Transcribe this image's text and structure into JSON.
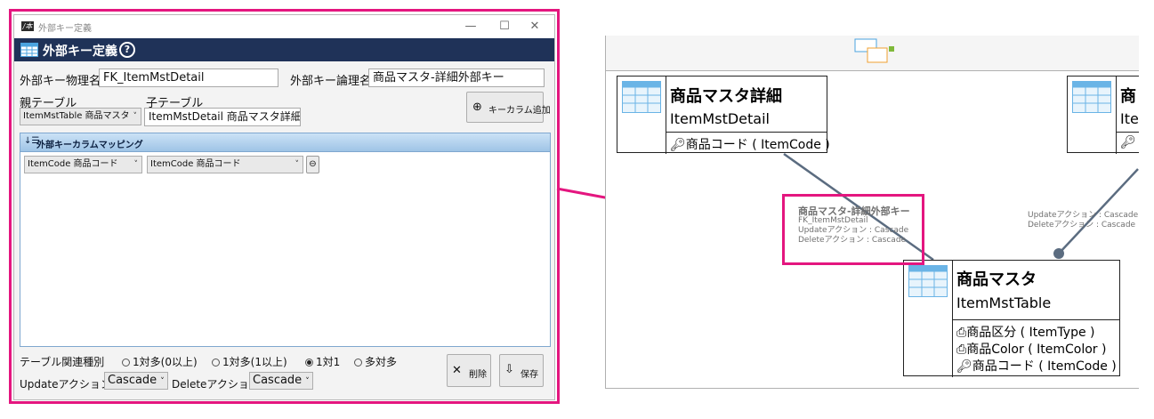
{
  "window": {
    "title": "外部キー定義",
    "app_icon": "/本",
    "minimize_glyph": "—",
    "maximize_glyph": "☐",
    "close_glyph": "✕"
  },
  "header": {
    "title": "外部キー定義",
    "help_glyph": "?"
  },
  "form": {
    "physical_name_label": "外部キー物理名",
    "physical_name_value": "FK_ItemMstDetail",
    "logical_name_label": "外部キー論理名",
    "logical_name_value": "商品マスタ-詳細外部キー",
    "parent_table_label": "親テーブル",
    "parent_table_value": "ItemMstTable 商品マスタ",
    "child_table_label": "子テーブル",
    "child_table_value": "ItemMstDetail 商品マスタ詳細",
    "add_key_column_label": "キーカラム追加"
  },
  "mapping": {
    "title": "外部キーカラムマッピング",
    "sort_glyph": "↓☰",
    "rows": [
      {
        "parent_column": "ItemCode 商品コード",
        "child_column": "ItemCode 商品コード"
      }
    ],
    "remove_glyph": "⊖"
  },
  "relation": {
    "label": "テーブル関連種別",
    "options": [
      "1対多(0以上)",
      "1対多(1以上)",
      "1対1",
      "多対多"
    ],
    "selected": "1対1"
  },
  "actions": {
    "update_label": "Updateアクション",
    "update_value": "Cascade",
    "delete_label": "Deleteアクション",
    "delete_value": "Cascade",
    "delete_button": "削除",
    "save_button": "保存"
  },
  "diagram": {
    "entities": [
      {
        "name": "商品マスタ詳細",
        "physical": "ItemMstDetail",
        "attributes": [
          "商品コード ( ItemCode )"
        ]
      },
      {
        "name": "商品マスタ",
        "physical": "ItemMstTable",
        "attributes": [
          "商品区分 ( ItemType )",
          "商品Color ( ItemColor )",
          "商品コード ( ItemCode )"
        ]
      },
      {
        "name": "商",
        "physical": "Ite",
        "attributes": [
          ""
        ]
      }
    ],
    "fk_label": {
      "title": "商品マスタ-詳細外部キー",
      "physical": "FK_ItemMstDetail",
      "update": "Updateアクション : Cascade",
      "delete": "Deleteアクション : Cascade"
    },
    "fk_label_right": {
      "update": "Updateアクション : Cascade",
      "delete": "Deleteアクション : Cascade"
    }
  },
  "colors": {
    "highlight": "#e4167f",
    "header_bg": "#1f3258",
    "connector": "#5b6c80"
  }
}
